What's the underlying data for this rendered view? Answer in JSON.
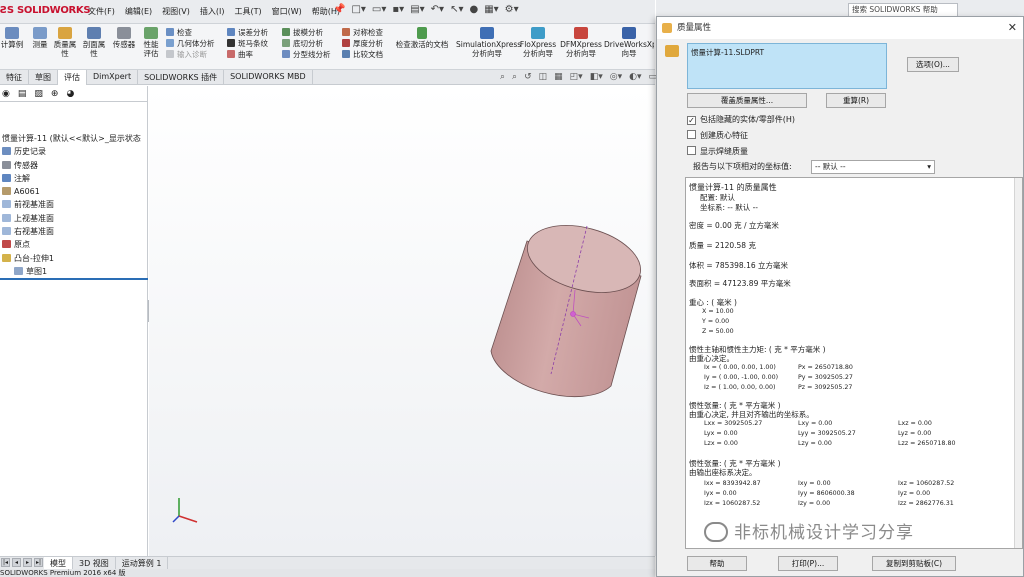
{
  "app": {
    "logo": "SOLIDWORKS",
    "menus": [
      "文件(F)",
      "编辑(E)",
      "视图(V)",
      "插入(I)",
      "工具(T)",
      "窗口(W)",
      "帮助(H)"
    ],
    "search_placeholder": "搜索 SOLIDWORKS 帮助"
  },
  "commands": {
    "big": [
      "计算例",
      "测量",
      "质量属性",
      "剖面属性",
      "传感器",
      "性能评估"
    ],
    "col1": [
      "检查",
      "几何体分析",
      "输入诊断"
    ],
    "col2": [
      "误差分析",
      "斑马条纹",
      "曲率"
    ],
    "col3": [
      "拔模分析",
      "底切分析",
      "分型线分析"
    ],
    "col4": [
      "对称检查",
      "厚度分析",
      "比较文档"
    ],
    "check_active_doc": "检查激活的文档",
    "sim": [
      "SimulationXpress 分析向导",
      "FloXpress 分析向导",
      "DFMXpress 分析向导",
      "DriveWorksXpress 向导"
    ]
  },
  "tabs": [
    "特征",
    "草图",
    "评估",
    "DimXpert",
    "SOLIDWORKS 插件",
    "SOLIDWORKS MBD"
  ],
  "active_tab": "评估",
  "tree": {
    "root": "惯量计算-11 (默认<<默认>_显示状态",
    "items": [
      "历史记录",
      "传感器",
      "注解",
      "A6061",
      "前视基准面",
      "上视基准面",
      "右视基准面",
      "原点",
      "凸台-拉伸1",
      "草图1"
    ]
  },
  "bottom_tabs": [
    "模型",
    "3D 视图",
    "运动算例 1"
  ],
  "status": "SOLIDWORKS Premium 2016 x64 版",
  "dialog": {
    "title": "质量属性",
    "window_title": "惯量计算-11",
    "selected": "惯量计算-11.SLDPRT",
    "options_btn": "选项(O)...",
    "override_btn": "覆盖质量属性...",
    "recalc_btn": "重算(R)",
    "chk_hidden": "包括隐藏的实体/零部件(H)",
    "chk_center": "创建质心特征",
    "chk_weld": "显示焊缝质量",
    "coord_label": "报告与以下项相对的坐标值:",
    "coord_value": "-- 默认 --",
    "help_btn": "帮助",
    "print_btn": "打印(P)...",
    "copy_btn": "复制到剪贴板(C)",
    "results": {
      "head": "惯量计算-11 的质量属性",
      "config": "配置: 默认",
      "coord": "坐标系: -- 默认 --",
      "density": "密度 = 0.00 克 / 立方毫米",
      "mass": "质量 = 2120.58 克",
      "volume": "体积 = 785398.16 立方毫米",
      "area": "表面积 = 47123.89 平方毫米",
      "com_head": "重心 : ( 毫米 )",
      "com": [
        "X = 10.00",
        "Y = 0.00",
        "Z = 50.00"
      ],
      "principal_head": "惯性主轴和惯性主力矩: ( 克 * 平方毫米 )",
      "principal_sub": "由重心决定。",
      "axes": [
        "Ix = ( 0.00, 0.00, 1.00)",
        "Iy = ( 0.00, -1.00, 0.00)",
        "Iz = ( 1.00, 0.00, 0.00)"
      ],
      "moments": [
        "Px = 2650718.80",
        "Py = 3092505.27",
        "Pz = 3092505.27"
      ],
      "tensor1_head": "惯性张量: ( 克 * 平方毫米 )",
      "tensor1_sub": "由重心决定, 并且对齐输出的坐标系。",
      "tensor1": [
        [
          "Lxx = 3092505.27",
          "Lxy = 0.00",
          "Lxz = 0.00"
        ],
        [
          "Lyx = 0.00",
          "Lyy = 3092505.27",
          "Lyz = 0.00"
        ],
        [
          "Lzx = 0.00",
          "Lzy = 0.00",
          "Lzz = 2650718.80"
        ]
      ],
      "tensor2_head": "惯性张量: ( 克 * 平方毫米 )",
      "tensor2_sub": "由输出座标系决定。",
      "tensor2": [
        [
          "Ixx = 8393942.87",
          "Ixy = 0.00",
          "Ixz = 1060287.52"
        ],
        [
          "Iyx = 0.00",
          "Iyy = 8606000.38",
          "Iyz = 0.00"
        ],
        [
          "Izx = 1060287.52",
          "Izy = 0.00",
          "Izz = 2862776.31"
        ]
      ]
    }
  },
  "watermark": "非标机械设计学习分享",
  "colors": {
    "cylinder": "#c9a0a0",
    "cylinder_top": "#d8b7b6",
    "selection": "#bfe3f7",
    "logo": "#c8102e"
  }
}
